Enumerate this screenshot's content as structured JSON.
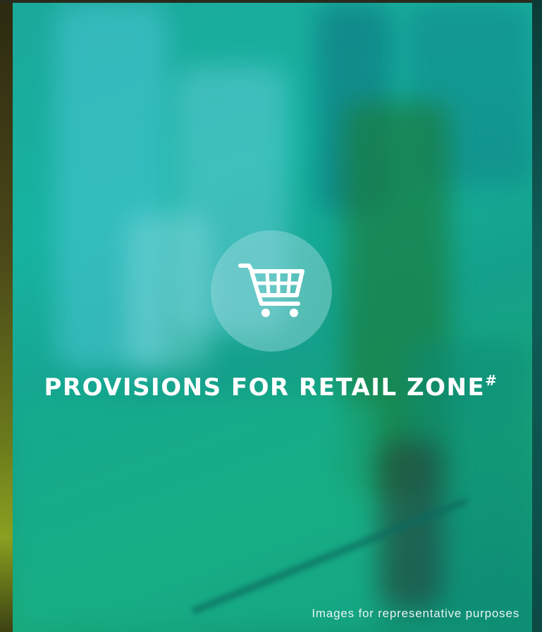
{
  "heading": {
    "text": "PROVISIONS FOR RETAIL ZONE",
    "superscript": "#"
  },
  "caption": "Images for representative purposes",
  "icon": {
    "name": "shopping-cart-icon",
    "color": "#ffffff",
    "circle_color": "#a0dce1"
  },
  "colors": {
    "tint": "#16b3a0",
    "text": "#ffffff"
  }
}
